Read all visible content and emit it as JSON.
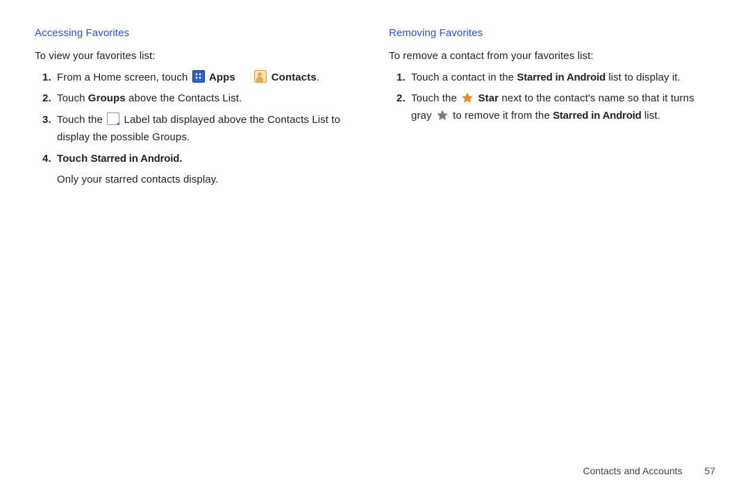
{
  "left": {
    "heading": "Accessing Favorites",
    "intro": "To view your favorites list:",
    "step1_a": "From a Home screen, touch ",
    "step1_apps": "Apps",
    "step1_contacts": "Contacts",
    "step1_period": ".",
    "step2_a": "Touch ",
    "step2_b": "Groups",
    "step2_c": " above the Contacts List.",
    "step3_a": "Touch the ",
    "step3_b": " Label tab displayed above the Contacts List to display the possible Groups.",
    "step4_lead": "Touch ",
    "step4_bold": "Starred in Android",
    "step4_period": ".",
    "step4_sub": "Only your starred contacts display."
  },
  "right": {
    "heading": "Removing Favorites",
    "intro": "To remove a contact from your favorites list:",
    "step1_a": "Touch a contact in the ",
    "step1_b": "Starred in Android",
    "step1_c": " list to display it.",
    "step2_a": "Touch the ",
    "step2_b": "Star",
    "step2_c": " next to the contact's name so that it turns gray ",
    "step2_d": " to remove it from the ",
    "step2_e": "Starred in Android",
    "step2_f": " list."
  },
  "footer": {
    "section": "Contacts and Accounts",
    "page": "57"
  }
}
